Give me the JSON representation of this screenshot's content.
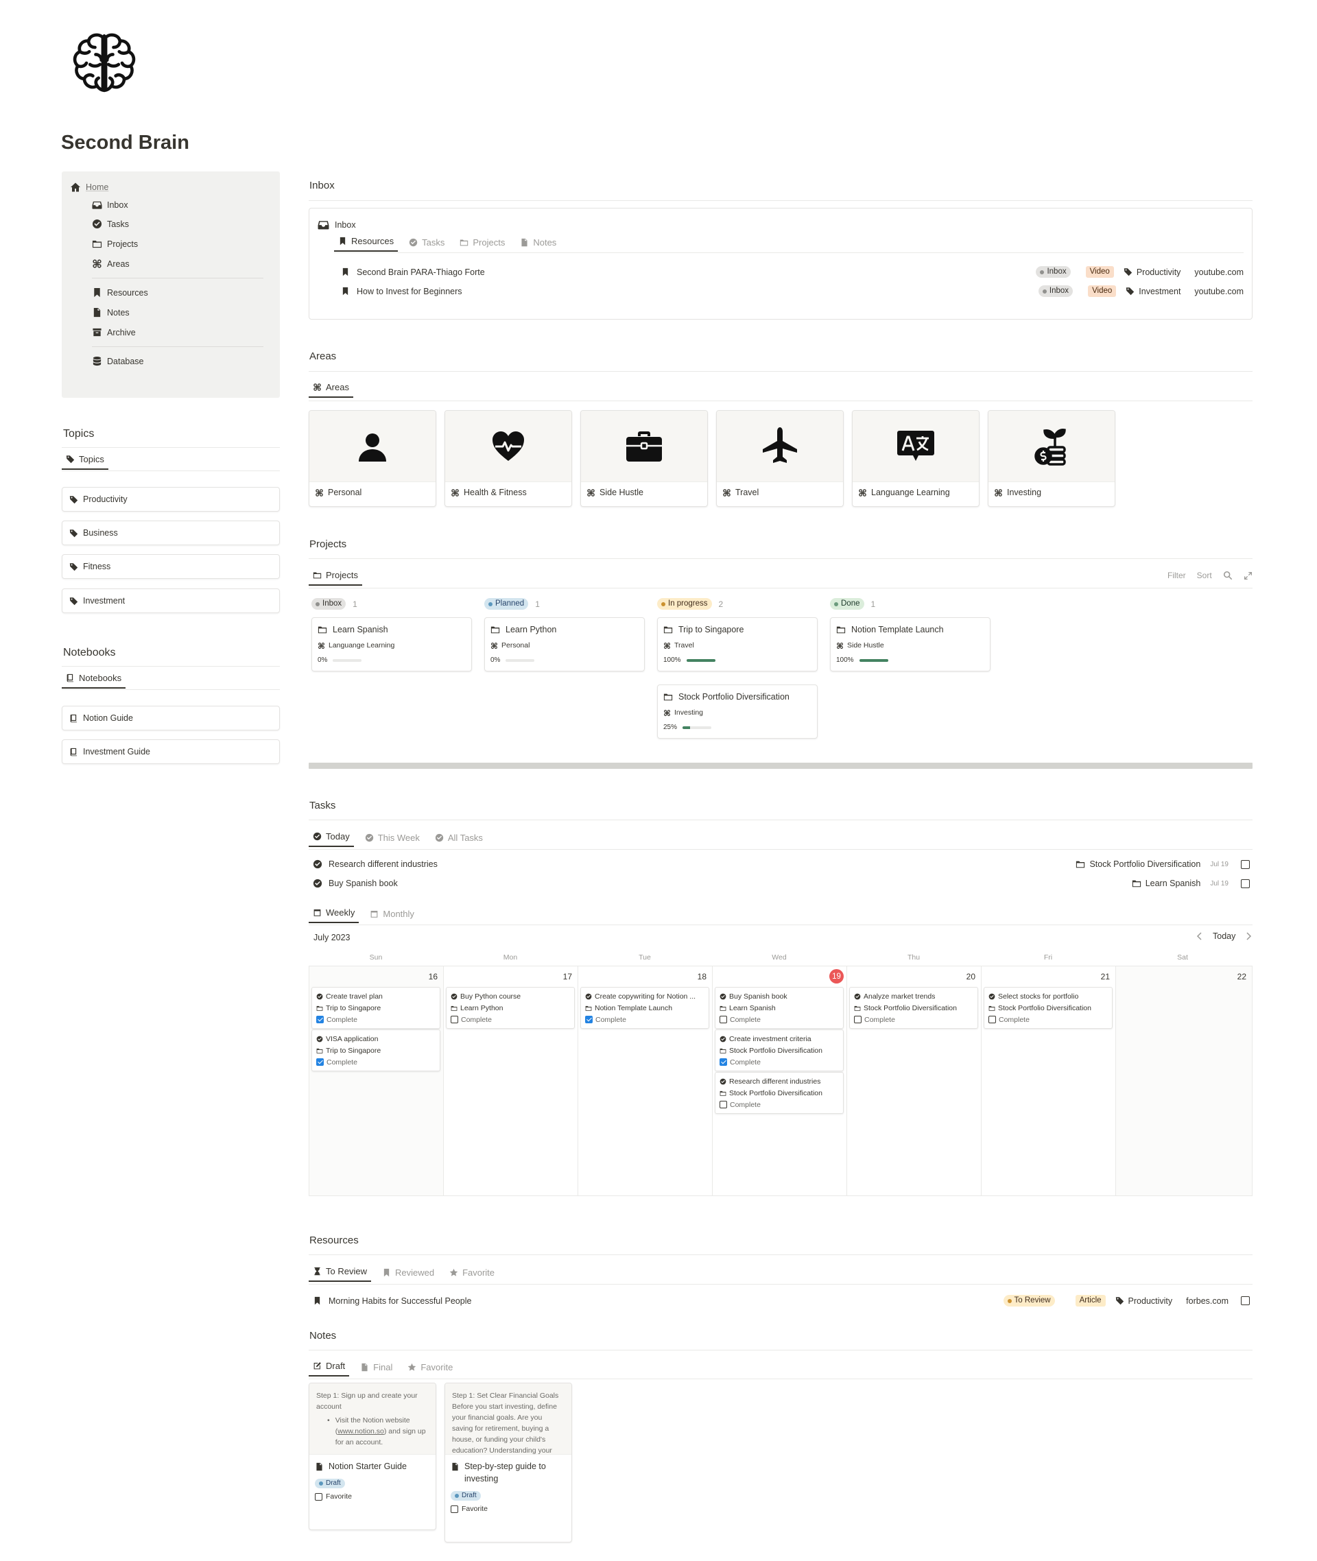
{
  "page": {
    "title": "Second Brain"
  },
  "sidebar": {
    "home": "Home",
    "items": [
      "Inbox",
      "Tasks",
      "Projects",
      "Areas"
    ],
    "items2": [
      "Resources",
      "Notes",
      "Archive"
    ],
    "database": "Database"
  },
  "topics": {
    "heading": "Topics",
    "tab": "Topics",
    "items": [
      "Productivity",
      "Business",
      "Fitness",
      "Investment"
    ]
  },
  "notebooks": {
    "heading": "Notebooks",
    "tab": "Notebooks",
    "items": [
      "Notion Guide",
      "Investment Guide"
    ]
  },
  "inbox": {
    "heading": "Inbox",
    "box_title": "Inbox",
    "tabs": [
      "Resources",
      "Tasks",
      "Projects",
      "Notes"
    ],
    "rows": [
      {
        "title": "Second Brain PARA-Thiago Forte",
        "status": "Inbox",
        "type": "Video",
        "topic": "Productivity",
        "url": "youtube.com"
      },
      {
        "title": "How to Invest for Beginners",
        "status": "Inbox",
        "type": "Video",
        "topic": "Investment",
        "url": "youtube.com"
      }
    ]
  },
  "areas": {
    "heading": "Areas",
    "tab": "Areas",
    "cards": [
      {
        "label": "Personal",
        "icon": "person-icon"
      },
      {
        "label": "Health & Fitness",
        "icon": "heart-pulse-icon"
      },
      {
        "label": "Side Hustle",
        "icon": "briefcase-icon"
      },
      {
        "label": "Travel",
        "icon": "airplane-icon"
      },
      {
        "label": "Languange Learning",
        "icon": "translate-icon"
      },
      {
        "label": "Investing",
        "icon": "money-plant-icon"
      }
    ]
  },
  "projects": {
    "heading": "Projects",
    "tab": "Projects",
    "toolbar": {
      "filter": "Filter",
      "sort": "Sort"
    },
    "columns": [
      {
        "name": "Inbox",
        "count": "1",
        "color": "gray",
        "cards": [
          {
            "title": "Learn Spanish",
            "area": "Languange Learning",
            "progress": "0%",
            "fill": 0
          }
        ]
      },
      {
        "name": "Planned",
        "count": "1",
        "color": "blue",
        "cards": [
          {
            "title": "Learn Python",
            "area": "Personal",
            "progress": "0%",
            "fill": 0
          }
        ]
      },
      {
        "name": "In progress",
        "count": "2",
        "color": "yellow",
        "cards": [
          {
            "title": "Trip to Singapore",
            "area": "Travel",
            "progress": "100%",
            "fill": 1
          },
          {
            "title": "Stock Portfolio Diversification",
            "area": "Investing",
            "progress": "25%",
            "fill": 0.25
          }
        ]
      },
      {
        "name": "Done",
        "count": "1",
        "color": "green",
        "cards": [
          {
            "title": "Notion Template Launch",
            "area": "Side Hustle",
            "progress": "100%",
            "fill": 1
          }
        ]
      }
    ]
  },
  "tasks": {
    "heading": "Tasks",
    "tabs": [
      "Today",
      "This Week",
      "All Tasks"
    ],
    "rows": [
      {
        "title": "Research different industries",
        "project": "Stock Portfolio Diversification",
        "date": "Jul 19"
      },
      {
        "title": "Buy Spanish book",
        "project": "Learn Spanish",
        "date": "Jul 19"
      }
    ],
    "cal_tabs": [
      "Weekly",
      "Monthly"
    ],
    "month": "July 2023",
    "today_btn": "Today",
    "days": [
      "Sun",
      "Mon",
      "Tue",
      "Wed",
      "Thu",
      "Fri",
      "Sat"
    ],
    "dates": [
      "16",
      "17",
      "18",
      "19",
      "20",
      "21",
      "22"
    ],
    "complete_label": "Complete",
    "events": [
      [
        {
          "title": "Create travel plan",
          "project": "Trip to Singapore",
          "done": true
        },
        {
          "title": "VISA application",
          "project": "Trip to Singapore",
          "done": true
        }
      ],
      [
        {
          "title": "Buy Python course",
          "project": "Learn Python",
          "done": false
        }
      ],
      [
        {
          "title": "Create copywriting for Notion ...",
          "project": "Notion Template Launch",
          "done": true
        }
      ],
      [
        {
          "title": "Buy Spanish book",
          "project": "Learn Spanish",
          "done": false
        },
        {
          "title": "Create investment criteria",
          "project": "Stock Portfolio Diversification",
          "done": true
        },
        {
          "title": "Research different industries",
          "project": "Stock Portfolio Diversification",
          "done": false
        }
      ],
      [
        {
          "title": "Analyze market trends",
          "project": "Stock Portfolio Diversification",
          "done": false
        }
      ],
      [
        {
          "title": "Select stocks for portfolio",
          "project": "Stock Portfolio Diversification",
          "done": false
        }
      ],
      []
    ]
  },
  "resources": {
    "heading": "Resources",
    "tabs": [
      "To Review",
      "Reviewed",
      "Favorite"
    ],
    "rows": [
      {
        "title": "Morning Habits for Successful People",
        "status": "To Review",
        "type": "Article",
        "topic": "Productivity",
        "url": "forbes.com"
      }
    ]
  },
  "notes": {
    "heading": "Notes",
    "tabs": [
      "Draft",
      "Final",
      "Favorite"
    ],
    "favorite_label": "Favorite",
    "cards": [
      {
        "preview_head": "Step 1: Sign up and create your account",
        "preview_bullet": "Visit the Notion website (",
        "preview_link": "www.notion.so",
        "preview_tail": ") and sign up for an account.",
        "title": "Notion Starter Guide",
        "status": "Draft"
      },
      {
        "preview_text": "Step 1: Set Clear Financial Goals Before you start investing, define your financial goals. Are you saving for retirement, buying a house, or funding your child's education? Understanding your",
        "title": "Step-by-step guide to investing",
        "status": "Draft"
      }
    ]
  },
  "colors": {
    "accent": "#2383e2",
    "today": "#eb5757",
    "progress": "#448361"
  }
}
